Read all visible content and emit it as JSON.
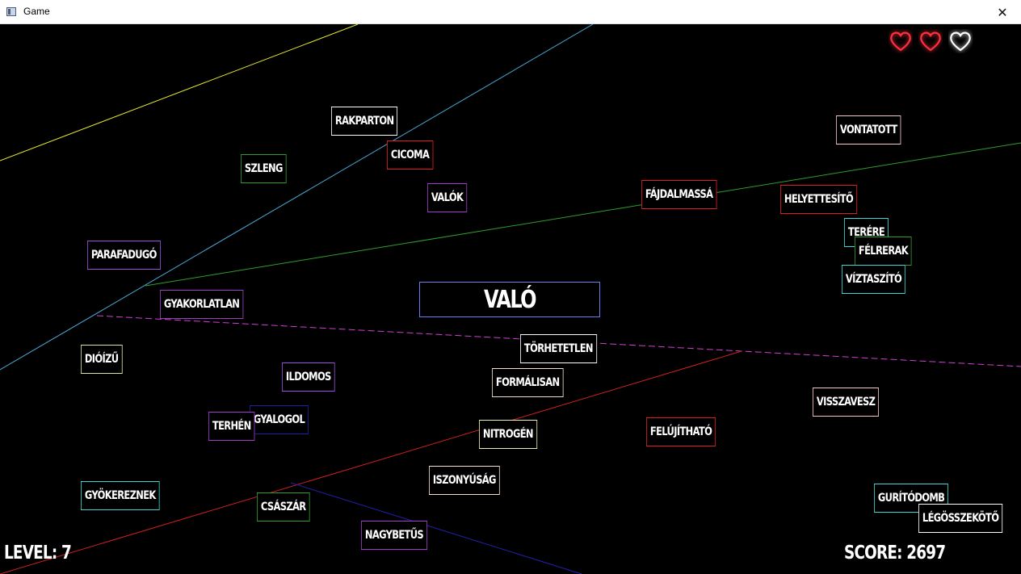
{
  "window": {
    "title": "Game",
    "close_glyph": "✕"
  },
  "target_word": "VALÓ",
  "hud": {
    "level_label": "LEVEL: 7",
    "score_label": "SCORE: 2697",
    "lives_total": 3,
    "lives_remaining": 2
  },
  "colors": {
    "heart_full": "#ff3040",
    "heart_empty": "#ffffff",
    "target_border": "#6a7cf0"
  },
  "words": [
    {
      "text": "RAKPARTON",
      "color": "#ffffff"
    },
    {
      "text": "CICOMA",
      "color": "#e02020"
    },
    {
      "text": "SZLENG",
      "color": "#2e9e2e"
    },
    {
      "text": "VALÓK",
      "color": "#a03cc8"
    },
    {
      "text": "VONTATOTT",
      "color": "#f4c8c8"
    },
    {
      "text": "FÁJDALMASSÁ",
      "color": "#e02020"
    },
    {
      "text": "HELYETTESÍTŐ",
      "color": "#e02020"
    },
    {
      "text": "TERÉRE",
      "color": "#40d8d8"
    },
    {
      "text": "FÉLRERAK",
      "color": "#2e9e2e"
    },
    {
      "text": "VÍZTASZÍTÓ",
      "color": "#40d8d8"
    },
    {
      "text": "PARAFADUGÓ",
      "color": "#9a50e0"
    },
    {
      "text": "GYAKORLATLAN",
      "color": "#a03cc8"
    },
    {
      "text": "TÖRHETETLEN",
      "color": "#ffffff"
    },
    {
      "text": "DIÓÍZŰ",
      "color": "#d8e8a0"
    },
    {
      "text": "ILDOMOS",
      "color": "#9a50e0"
    },
    {
      "text": "FORMÁLISAN",
      "color": "#f4e0d0"
    },
    {
      "text": "VISSZAVESZ",
      "color": "#f4c8c8"
    },
    {
      "text": "GYALOGOL",
      "color": "#2020a0"
    },
    {
      "text": "TERHÉN",
      "color": "#a03cc8"
    },
    {
      "text": "NITROGÉN",
      "color": "#f0f0b0"
    },
    {
      "text": "FELÚJÍTHATÓ",
      "color": "#e02020"
    },
    {
      "text": "ISZONYÚSÁG",
      "color": "#f4e0d0"
    },
    {
      "text": "GYÖKEREZNEK",
      "color": "#40d8d8"
    },
    {
      "text": "CSÁSZÁR",
      "color": "#2e9e2e"
    },
    {
      "text": "NAGYBETŰS",
      "color": "#a03cc8"
    },
    {
      "text": "GURÍTÓDOMB",
      "color": "#40d8d8"
    },
    {
      "text": "LÉGÖSSZEKÖTŐ",
      "color": "#ffffff"
    }
  ]
}
